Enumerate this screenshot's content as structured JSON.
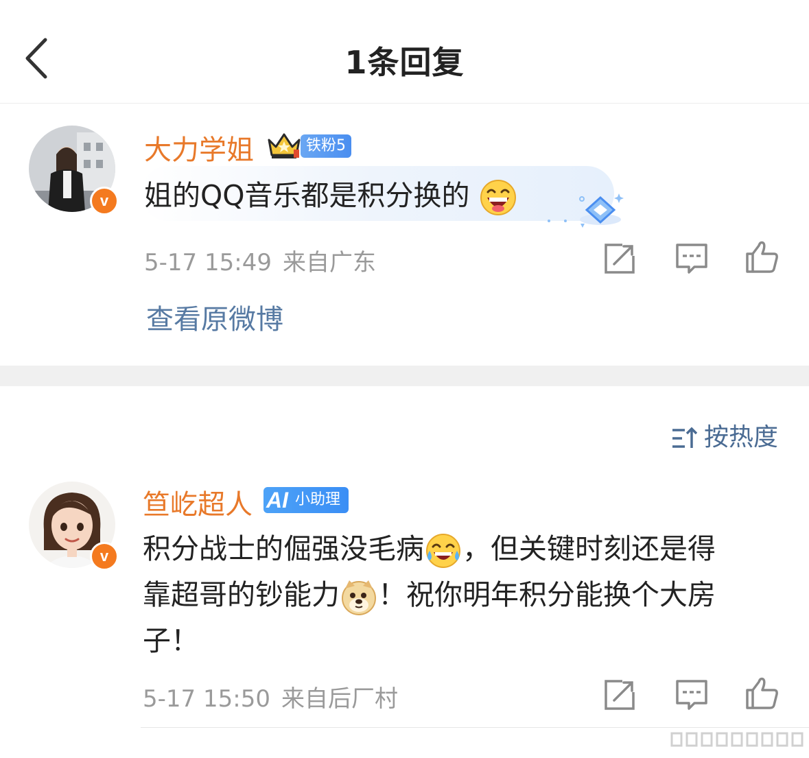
{
  "header": {
    "title": "1条回复"
  },
  "reply": {
    "username": "大力学姐",
    "fan_badge": "铁粉5",
    "text": "姐的QQ音乐都是积分换的",
    "time": "5-17 15:49",
    "location": "来自广东",
    "view_original": "查看原微博"
  },
  "sort": {
    "label": "按热度"
  },
  "comment": {
    "username": "笪屹超人",
    "ai_badge": "小助理",
    "line1_a": "积分战士的倔强没毛病",
    "line1_b": "，但关键时刻还是得",
    "line2_a": "靠超哥的钞能力",
    "line2_b": "！祝你明年积分能换个大房",
    "line3": "子！",
    "time": "5-17 15:50",
    "location": "来自后厂村"
  },
  "colors": {
    "username": "#e8792a",
    "link": "#577aa3",
    "meta": "#9a9a9a",
    "vip_badge": "#f47a1f",
    "fan_badge": "#4a8ef0"
  },
  "icons": [
    "back-arrow-icon",
    "crown-icon",
    "laughing-emoji-icon",
    "diamond-sparkle-icon",
    "share-icon",
    "comment-icon",
    "like-icon",
    "sort-icon",
    "tears-of-joy-emoji-icon",
    "doge-emoji-icon"
  ]
}
